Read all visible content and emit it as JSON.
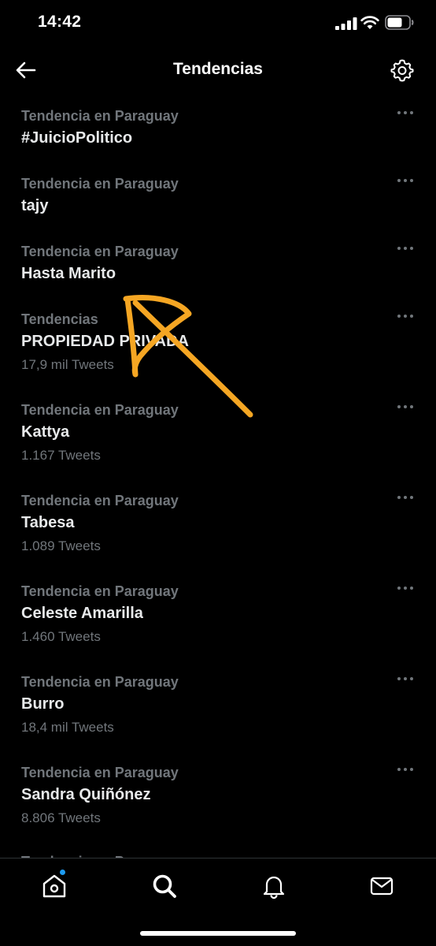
{
  "status_bar": {
    "time": "14:42"
  },
  "header": {
    "title": "Tendencias"
  },
  "trends": [
    {
      "context": "Tendencia en Paraguay",
      "name": "#JuicioPolitico",
      "count": ""
    },
    {
      "context": "Tendencia en Paraguay",
      "name": "tajy",
      "count": ""
    },
    {
      "context": "Tendencia en Paraguay",
      "name": "Hasta Marito",
      "count": ""
    },
    {
      "context": "Tendencias",
      "name": "PROPIEDAD PRIVADA",
      "count": "17,9 mil Tweets"
    },
    {
      "context": "Tendencia en Paraguay",
      "name": "Kattya",
      "count": "1.167 Tweets"
    },
    {
      "context": "Tendencia en Paraguay",
      "name": "Tabesa",
      "count": "1.089 Tweets"
    },
    {
      "context": "Tendencia en Paraguay",
      "name": "Celeste Amarilla",
      "count": "1.460 Tweets"
    },
    {
      "context": "Tendencia en Paraguay",
      "name": "Burro",
      "count": "18,4 mil Tweets"
    },
    {
      "context": "Tendencia en Paraguay",
      "name": "Sandra Quiñónez",
      "count": "8.806 Tweets"
    }
  ],
  "partial_item": {
    "context": "Tendencia en Paraguay"
  },
  "icons": {
    "back": "arrow-left-icon",
    "settings": "gear-icon",
    "more": "more-horizontal-icon",
    "home": "home-icon",
    "search": "search-icon",
    "notifications": "bell-icon",
    "messages": "envelope-icon"
  },
  "colors": {
    "background": "#000000",
    "primary_text": "#e7e9ea",
    "secondary_text": "#71767b",
    "annotation": "#f5a623",
    "notification_dot": "#1d9bf0"
  }
}
